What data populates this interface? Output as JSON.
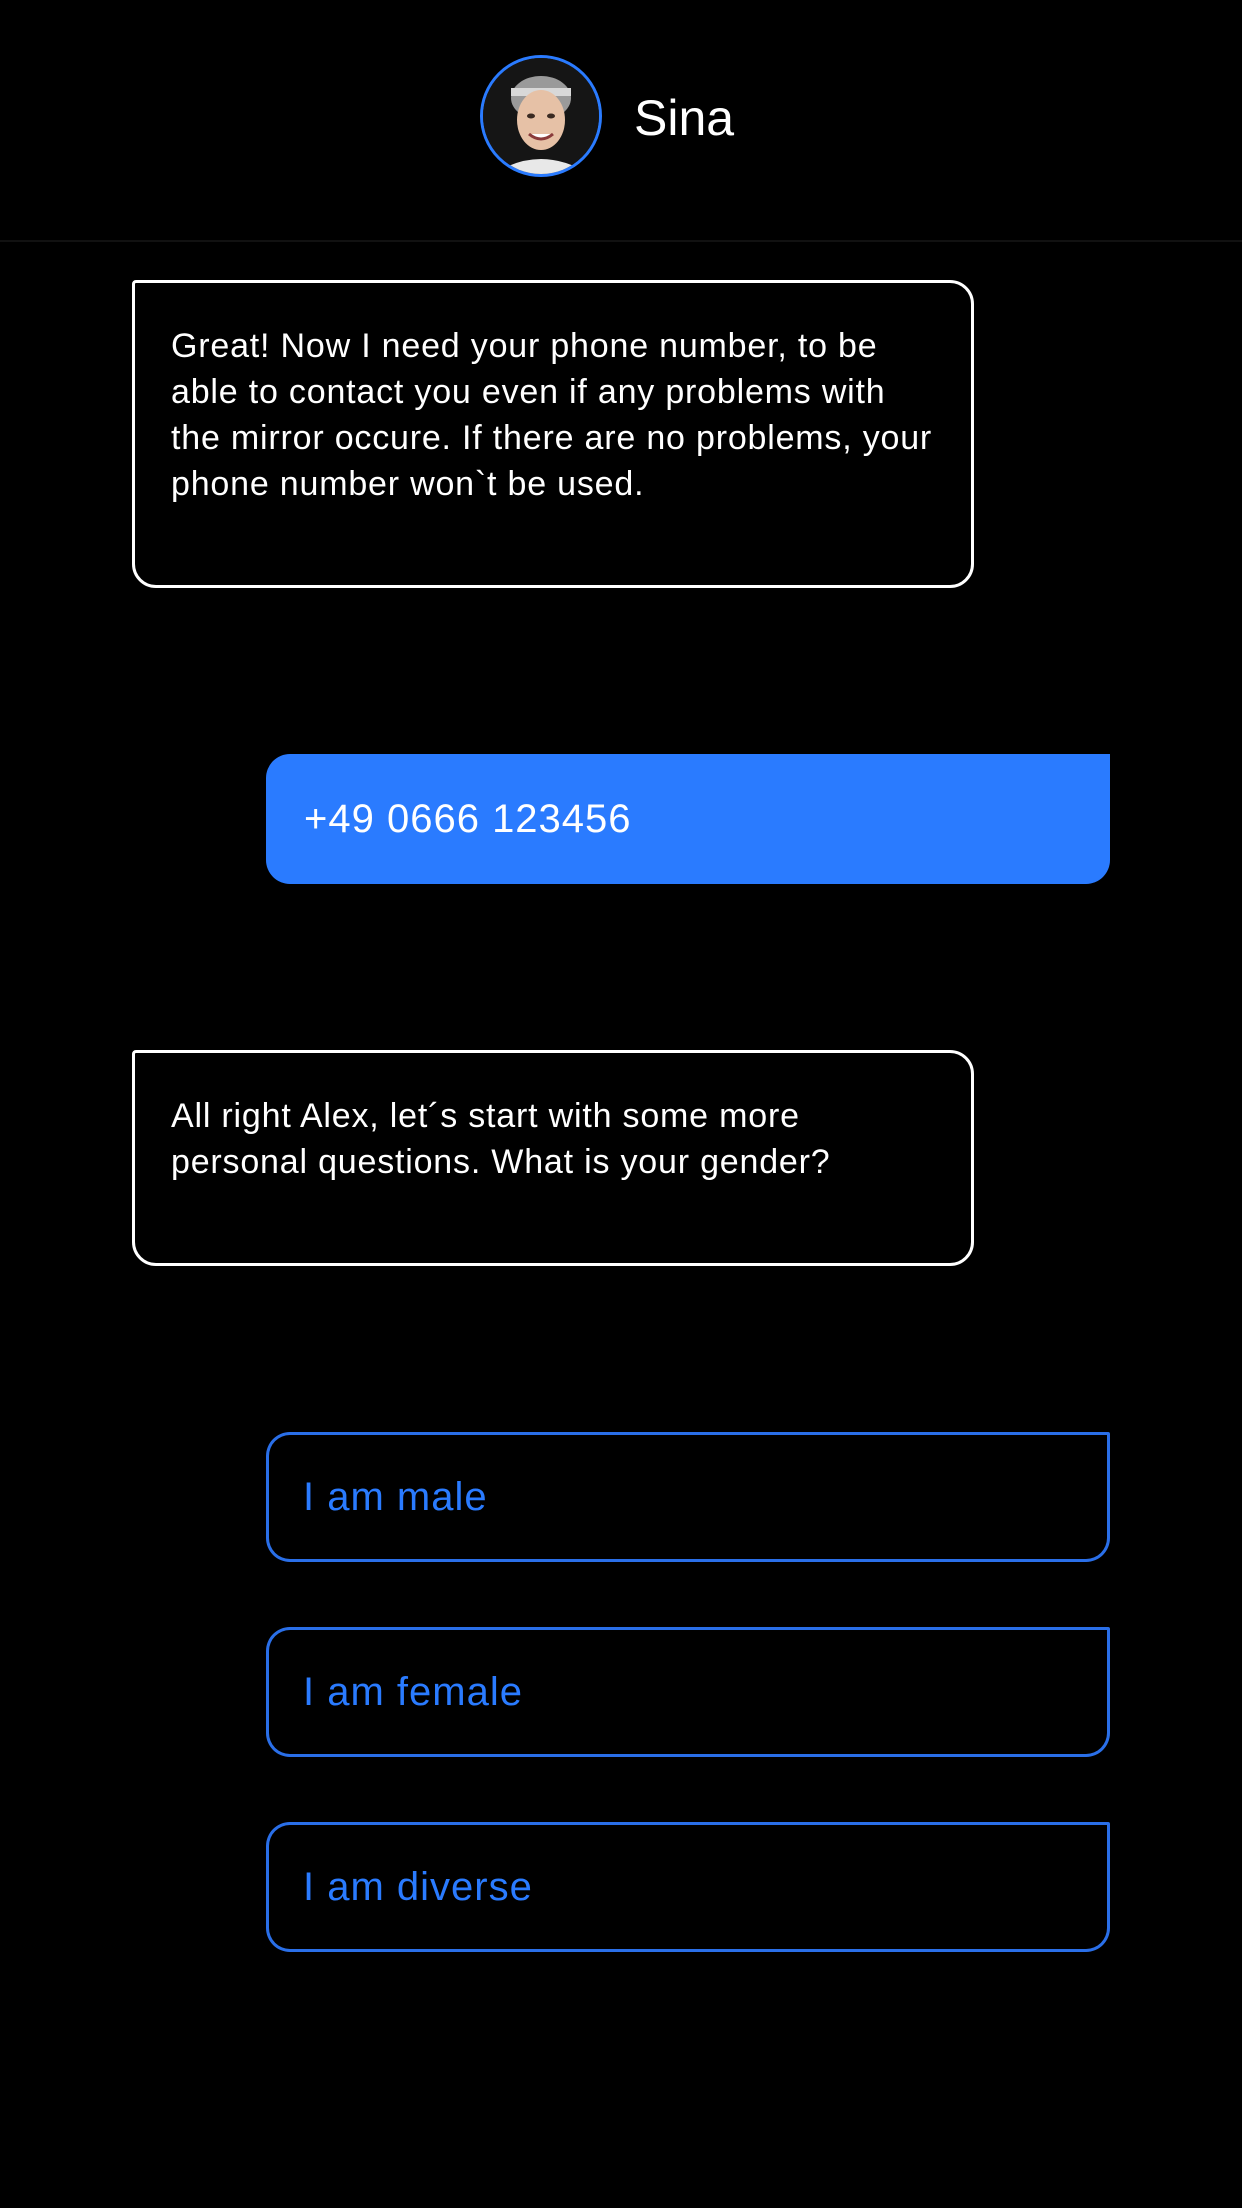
{
  "header": {
    "contact_name": "Sina",
    "avatar_icon": "person-portrait-avatar"
  },
  "messages": [
    {
      "sender": "Sina",
      "text": "Great! Now I need your phone number, to be able to contact you even if any problems with the mirror occure. If there are no problems, your phone number won`t be used."
    },
    {
      "sender": "user",
      "text": "+49 0666 123456"
    },
    {
      "sender": "Sina",
      "text": "All right Alex, let´s start with some more personal questions. What is your gender?"
    }
  ],
  "options": [
    {
      "label": "I am male"
    },
    {
      "label": "I am female"
    },
    {
      "label": "I am diverse"
    }
  ],
  "colors": {
    "background": "#000000",
    "accent": "#2a7bff",
    "text": "#ffffff"
  }
}
